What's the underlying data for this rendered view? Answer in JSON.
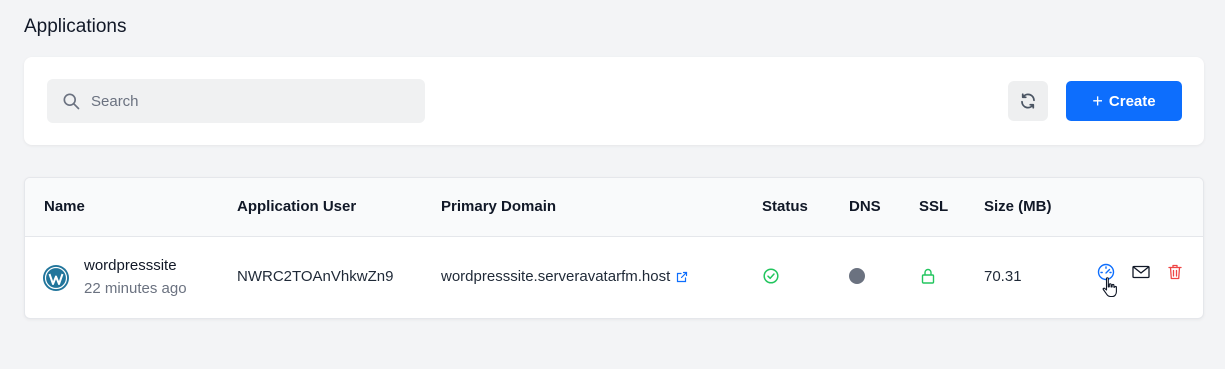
{
  "page": {
    "title": "Applications"
  },
  "toolbar": {
    "search_placeholder": "Search",
    "create_label": "Create",
    "create_plus": "+"
  },
  "table": {
    "headers": [
      "Name",
      "Application User",
      "Primary Domain",
      "Status",
      "DNS",
      "SSL",
      "Size (MB)"
    ],
    "rows": [
      {
        "name": "wordpresssite",
        "created": "22 minutes ago",
        "app_user": "NWRC2TOAnVhkwZn9",
        "domain": "wordpresssite.serveravatarfm.host",
        "status_icon": "check-circle-icon",
        "dns_icon": "dns-status-dot-icon",
        "ssl_icon": "lock-icon",
        "size_mb": "70.31",
        "actions": [
          "dashboard-gauge-icon",
          "mail-icon",
          "trash-icon"
        ]
      }
    ]
  },
  "colors": {
    "primary": "#0d6efd",
    "status_ok": "#22c55e",
    "dns_dot": "#6b7280",
    "danger": "#ef4444",
    "wordpress": "#21759b"
  }
}
